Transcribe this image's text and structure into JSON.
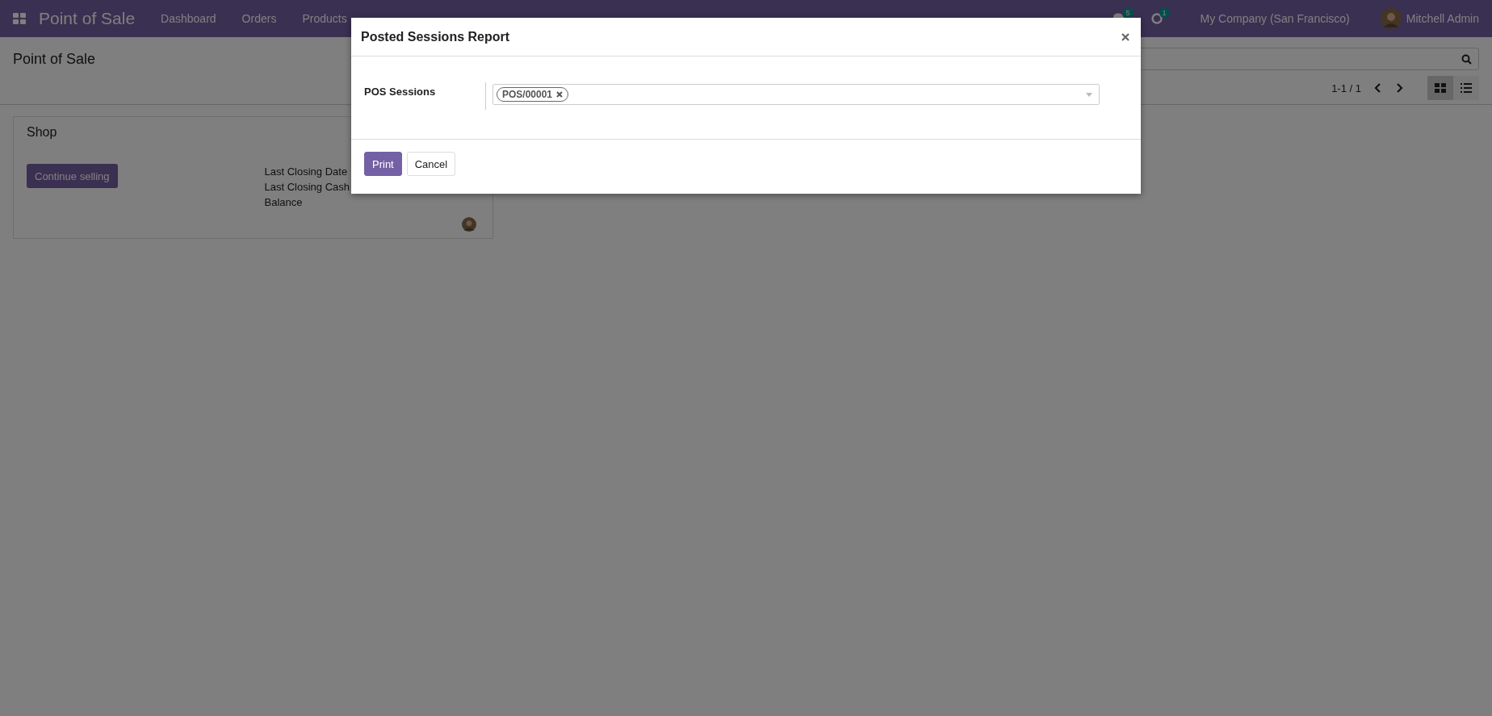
{
  "navbar": {
    "app_title": "Point of Sale",
    "menu": [
      "Dashboard",
      "Orders",
      "Products"
    ],
    "messages_badge": "5",
    "activities_badge": "1",
    "company": "My Company (San Francisco)",
    "user": "Mitchell Admin"
  },
  "control_panel": {
    "title": "Point of Sale",
    "pager": "1-1 / 1",
    "views": [
      {
        "kind": "kanban",
        "selected": true
      },
      {
        "kind": "list",
        "selected": false
      }
    ]
  },
  "card": {
    "title": "Shop",
    "action": "Continue selling",
    "details": [
      "Last Closing Date",
      "Last Closing Cash",
      "Balance"
    ]
  },
  "dialog": {
    "title": "Posted Sessions Report",
    "field_label": "POS Sessions",
    "tags": [
      "POS/00001"
    ],
    "buttons": [
      {
        "label": "Print",
        "kind": "primary"
      },
      {
        "label": "Cancel",
        "kind": "secondary"
      }
    ]
  }
}
